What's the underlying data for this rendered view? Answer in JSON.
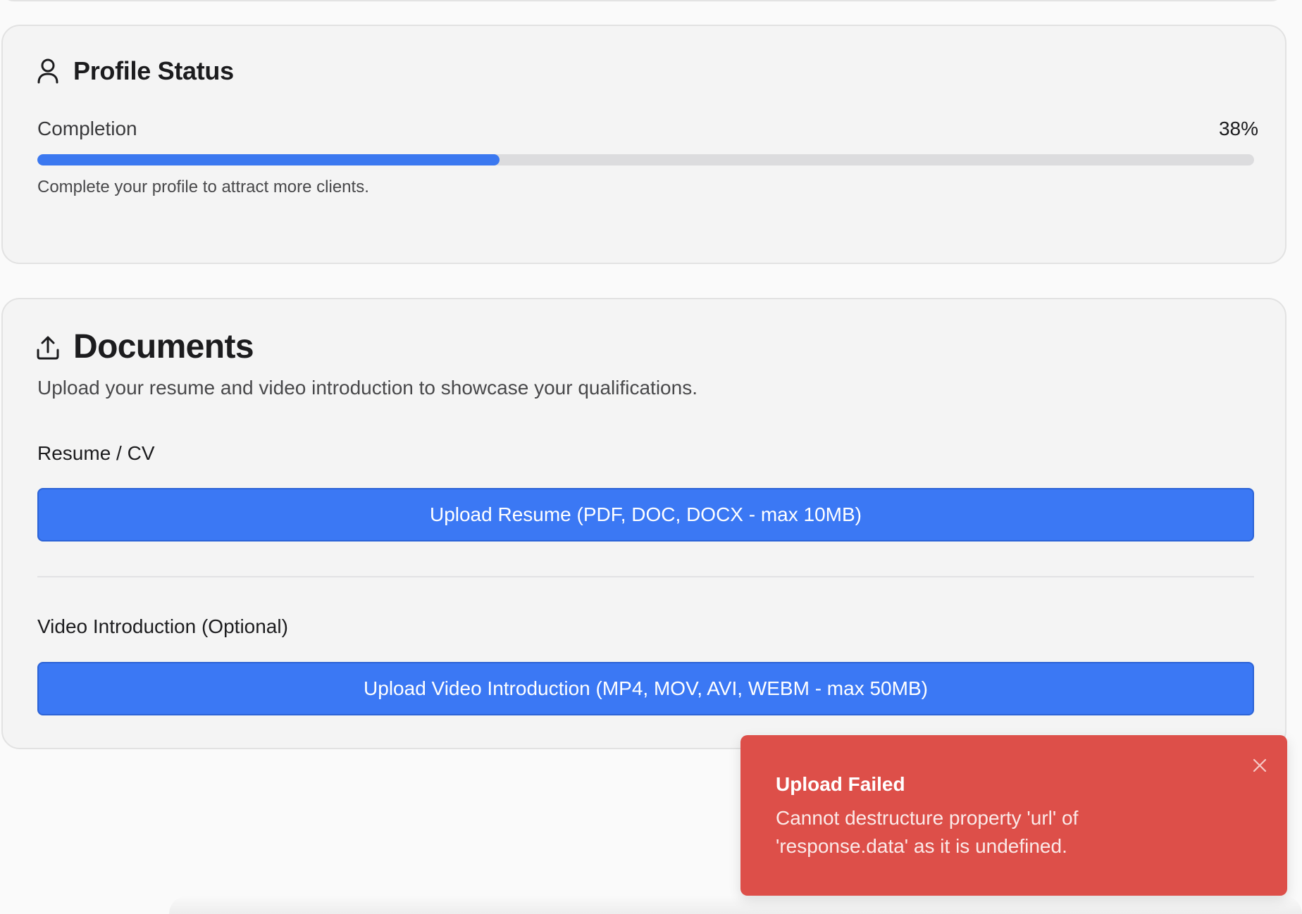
{
  "profile_status": {
    "title": "Profile Status",
    "icon": "user-icon",
    "completion_label": "Completion",
    "completion_value": "38%",
    "completion_fraction": 0.38,
    "hint": "Complete your profile to attract more clients.",
    "progress_color": "#3b78f0"
  },
  "documents": {
    "title": "Documents",
    "icon": "upload-icon",
    "subtitle": "Upload your resume and video introduction to showcase your qualifications.",
    "resume": {
      "label": "Resume / CV",
      "button_label": "Upload Resume (PDF, DOC, DOCX - max 10MB)"
    },
    "video": {
      "label": "Video Introduction (Optional)",
      "button_label": "Upload Video Introduction (MP4, MOV, AVI, WEBM - max 50MB)"
    },
    "button_color": "#3b78f4"
  },
  "toast": {
    "title": "Upload Failed",
    "message": "Cannot destructure property 'url' of 'response.data' as it is undefined.",
    "close_icon": "close-icon",
    "color": "#dd4f49"
  }
}
